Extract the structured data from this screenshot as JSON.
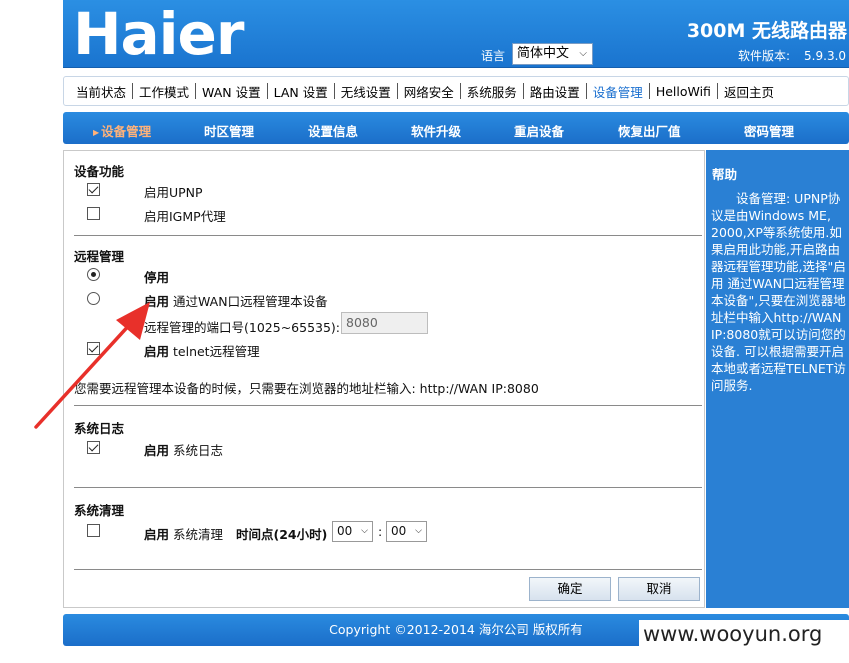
{
  "header": {
    "logo_text": "Haier",
    "product_title": "300M 无线路由器",
    "language_label": "语言",
    "language_value": "简体中文",
    "version_label": "软件版本:",
    "version_value": "5.9.3.0"
  },
  "topnav": {
    "items": [
      "当前状态",
      "工作模式",
      "WAN 设置",
      "LAN 设置",
      "无线设置",
      "网络安全",
      "系统服务",
      "路由设置",
      "设备管理",
      "HelloWifi",
      "返回主页"
    ],
    "active_index": 8
  },
  "subnav": {
    "items": [
      "设备管理",
      "时区管理",
      "设置信息",
      "软件升级",
      "重启设备",
      "恢复出厂值",
      "密码管理"
    ],
    "active_index": 0
  },
  "device_function": {
    "title": "设备功能",
    "upnp": {
      "label": "启用UPNP",
      "checked": true
    },
    "igmp": {
      "label": "启用IGMP代理",
      "checked": false
    }
  },
  "remote": {
    "title": "远程管理",
    "disable_label": "停用",
    "enable_label": "启用",
    "enable_desc": "通过WAN口远程管理本设备",
    "selected": "disable",
    "port_label": "远程管理的端口号(1025~65535):",
    "port_value": "8080",
    "telnet_enable": "启用",
    "telnet_label": "telnet远程管理",
    "telnet_checked": true,
    "note": "您需要远程管理本设备的时候，只需要在浏览器的地址栏输入: http://WAN IP:8080"
  },
  "syslog": {
    "title": "系统日志",
    "enable": "启用",
    "label": "系统日志",
    "checked": true
  },
  "cleanup": {
    "title": "系统清理",
    "enable": "启用",
    "label": "系统清理",
    "checked": false,
    "time_label": "时间点(24小时)",
    "hour": "00",
    "colon": ":",
    "minute": "00"
  },
  "buttons": {
    "ok": "确定",
    "cancel": "取消"
  },
  "help": {
    "title": "帮助",
    "text": "设备管理: UPNP协议是由Windows ME, 2000,XP等系统使用.如果启用此功能,开启路由器远程管理功能,选择\"启用 通过WAN口远程管理本设备\",只要在浏览器地址栏中输入http://WAN IP:8080就可以访问您的设备. 可以根据需要开启本地或者远程TELNET访问服务."
  },
  "footer": {
    "copyright": "Copyright ©2012-2014 海尔公司 版权所有"
  },
  "watermark": "www.wooyun.org",
  "colors": {
    "brand_blue": "#1b74cf",
    "help_blue": "#2a80d4",
    "arrow_red": "#e8302a",
    "active_subnav": "#ffb27a"
  }
}
